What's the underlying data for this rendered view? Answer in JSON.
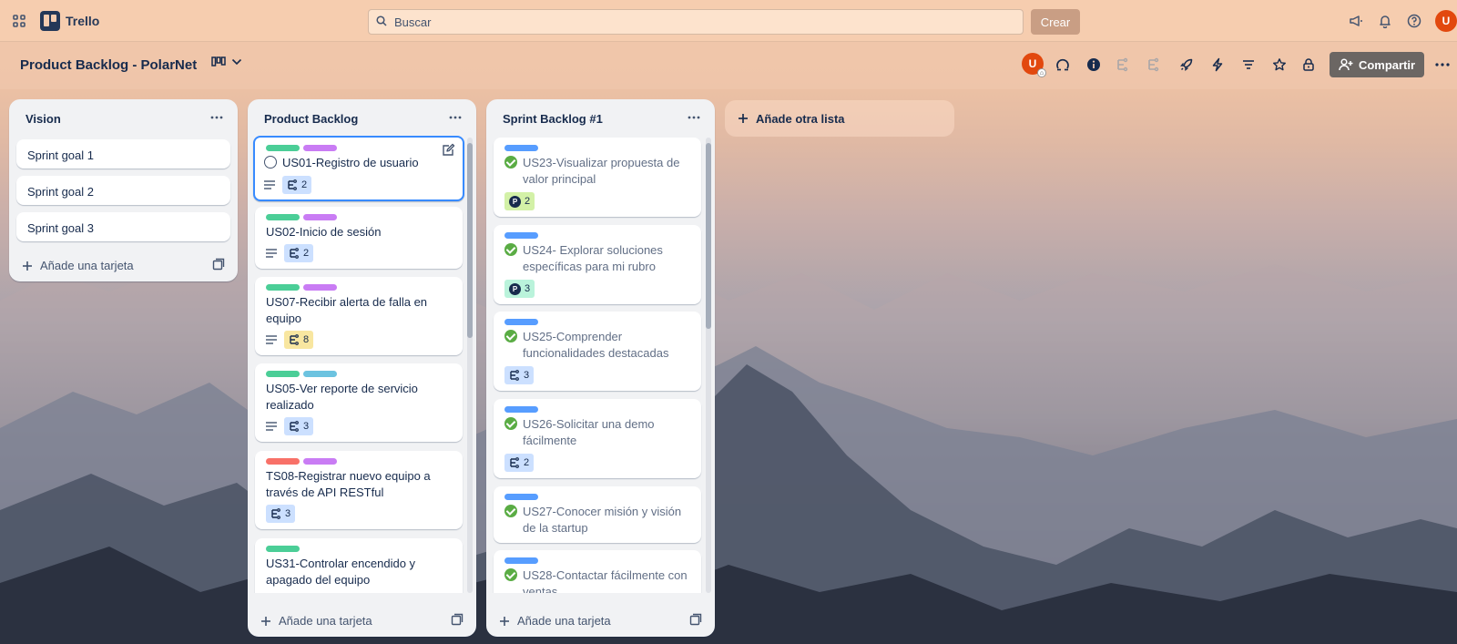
{
  "app": {
    "name": "Trello"
  },
  "topbar": {
    "search_placeholder": "Buscar",
    "create_label": "Crear",
    "avatar_initial": "U"
  },
  "board": {
    "title": "Product Backlog - PolarNet",
    "member_initial": "U",
    "share_label": "Compartir"
  },
  "colors": {
    "green": "#4bce97",
    "purple": "#c97cf4",
    "blue": "#6cc3e0",
    "red": "#f87168",
    "sky": "#579dff"
  },
  "lists": [
    {
      "title": "Vision",
      "cards": [
        {
          "title": "Sprint goal 1"
        },
        {
          "title": "Sprint goal 2"
        },
        {
          "title": "Sprint goal 3"
        }
      ],
      "add_card_label": "Añade una tarjeta"
    },
    {
      "title": "Product Backlog",
      "cards": [
        {
          "title": "US01-Registro de usuario",
          "labels": [
            "green",
            "purple"
          ],
          "has_description": true,
          "points": "2",
          "badge_color": "blue",
          "selected": true
        },
        {
          "title": "US02-Inicio de sesión",
          "labels": [
            "green",
            "purple"
          ],
          "has_description": true,
          "points": "2",
          "badge_color": "blue"
        },
        {
          "title_line1": "US07-Recibir alerta de falla en",
          "title_line2": "equipo",
          "labels": [
            "green",
            "purple"
          ],
          "has_description": true,
          "points": "8",
          "badge_color": "yellow"
        },
        {
          "title_line1": "US05-Ver reporte de servicio",
          "title_line2": "realizado",
          "labels": [
            "green",
            "blue"
          ],
          "has_description": true,
          "points": "3",
          "badge_color": "blue"
        },
        {
          "title_line1": "TS08-Registrar nuevo equipo a",
          "title_line2": "través de API RESTful",
          "labels": [
            "red",
            "purple"
          ],
          "points": "3",
          "badge_color": "blue"
        },
        {
          "title_line1": "US31-Controlar encendido y",
          "title_line2": "apagado del equipo",
          "labels": [
            "green"
          ]
        }
      ],
      "add_card_label": "Añade una tarjeta"
    },
    {
      "title": "Sprint Backlog #1",
      "cards": [
        {
          "title_line1": "US23-Visualizar propuesta de",
          "title_line2": "valor principal",
          "labels": [
            "sky"
          ],
          "points": "2",
          "badge_color": "lime",
          "badge_type": "P"
        },
        {
          "title_line1": "US24- Explorar soluciones",
          "title_line2": "específicas para mi rubro",
          "labels": [
            "sky"
          ],
          "points": "3",
          "badge_color": "green",
          "badge_type": "P"
        },
        {
          "title_line1": "US25-Comprender",
          "title_line2": "funcionalidades destacadas",
          "labels": [
            "sky"
          ],
          "points": "3",
          "badge_color": "blue"
        },
        {
          "title_line1": "US26-Solicitar una demo",
          "title_line2": "fácilmente",
          "labels": [
            "sky"
          ],
          "points": "2",
          "badge_color": "blue"
        },
        {
          "title_line1": "US27-Conocer misión y visión",
          "title_line2": "de la startup",
          "labels": [
            "sky"
          ]
        },
        {
          "title_line1": "US28-Contactar fácilmente con",
          "title_line2": "ventas",
          "labels": [
            "sky"
          ]
        }
      ],
      "add_card_label": "Añade una tarjeta"
    }
  ],
  "add_list_label": "Añade otra lista"
}
